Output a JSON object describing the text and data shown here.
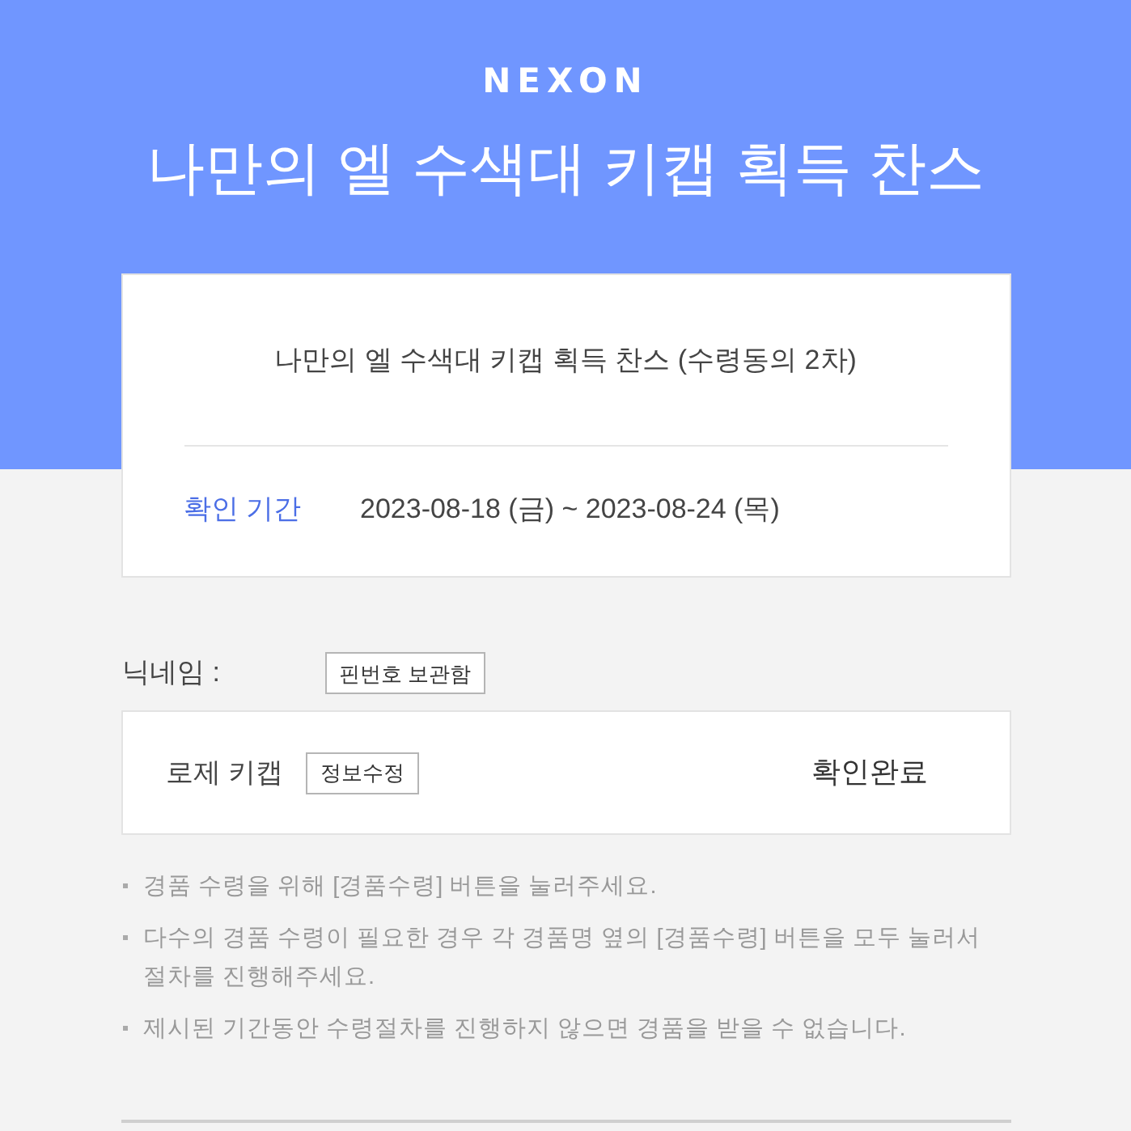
{
  "logo": "NEXON",
  "title": "나만의 엘 수색대 키캡 획득 찬스",
  "event": {
    "name": "나만의 엘 수색대 키캡 획득 찬스 (수령동의 2차)",
    "period_label": "확인 기간",
    "period": "2023-08-18 (금) ~ 2023-08-24 (목)"
  },
  "nickname": {
    "label": "닉네임 :",
    "button": "핀번호 보관함"
  },
  "items": [
    {
      "name": "로제 키캡",
      "button": "정보수정",
      "status": "확인완료"
    }
  ],
  "notes": [
    "경품 수령을 위해 [경품수령] 버튼을 눌러주세요.",
    "다수의 경품 수령이 필요한 경우 각 경품명 옆의 [경품수령] 버튼을 모두 눌러서 절차를 진행해주세요.",
    "제시된 기간동안 수령절차를 진행하지 않으면 경품을 받을 수 없습니다."
  ]
}
